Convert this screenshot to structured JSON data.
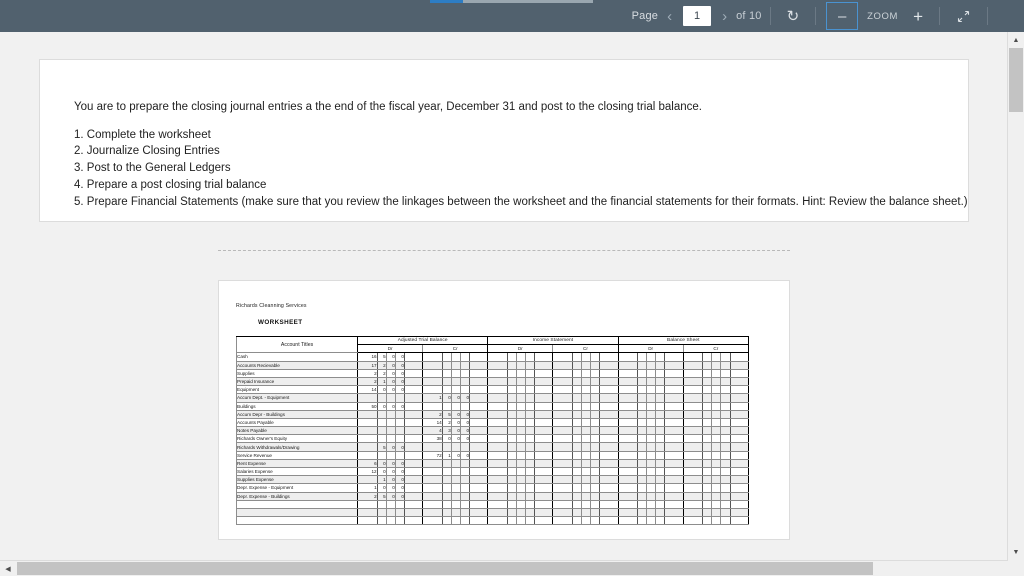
{
  "toolbar": {
    "page_label": "Page",
    "prev_icon": "chevron-left-icon",
    "page_value": "1",
    "next_icon": "chevron-right-icon",
    "of_label": "of 10",
    "rotate_icon": "rotate-icon",
    "zoom_out_label": "–",
    "zoom_label": "ZOOM",
    "zoom_in_label": "+",
    "fit_icon": "fit-to-width-icon",
    "accent_color": "#4a93d1",
    "bar_color": "#51616e"
  },
  "progress": {
    "percent": 20,
    "fill_color": "#2d7dc4",
    "track_color": "#9aa7b0"
  },
  "document": {
    "page1": {
      "lead": "You are to prepare the closing journal entries a the end of the fiscal year, December 31 and post to the closing trial balance.",
      "items": [
        "1. Complete the worksheet",
        "2. Journalize Closing Entries",
        "3. Post to the General Ledgers",
        "4. Prepare a post closing trial balance",
        "5. Prepare Financial Statements (make sure that you review the linkages between the worksheet and the financial statements for their formats.  Hint:  Review the balance sheet.)"
      ]
    },
    "page2": {
      "company": "Richards Cleanning Services",
      "title": "WORKSHEET",
      "account_header": "Account Titles",
      "groups": [
        "Adjusted Trial Balance",
        "Income Statement",
        "Balance Sheet"
      ],
      "dr_label": "Dr",
      "cr_label": "Cr",
      "rows": [
        {
          "account": "Cash",
          "atb_dr": [
            "16",
            "5",
            "0",
            "0"
          ],
          "atb_cr": [
            "",
            "",
            "",
            ""
          ]
        },
        {
          "account": "Accounts Recievable",
          "atb_dr": [
            "17",
            "2",
            "0",
            "0"
          ],
          "atb_cr": [
            "",
            "",
            "",
            ""
          ]
        },
        {
          "account": "Supplies",
          "atb_dr": [
            "2",
            "2",
            "0",
            "0"
          ],
          "atb_cr": [
            "",
            "",
            "",
            ""
          ]
        },
        {
          "account": "Prepaid Insurance",
          "atb_dr": [
            "2",
            "1",
            "0",
            "0"
          ],
          "atb_cr": [
            "",
            "",
            "",
            ""
          ]
        },
        {
          "account": "Equipment",
          "atb_dr": [
            "14",
            "0",
            "0",
            "0"
          ],
          "atb_cr": [
            "",
            "",
            "",
            ""
          ]
        },
        {
          "account": "Accum Dept. - Equipment",
          "atb_dr": [
            "",
            "",
            "",
            ""
          ],
          "atb_cr": [
            "1",
            "0",
            "0",
            "0"
          ]
        },
        {
          "account": "Buildings",
          "atb_dr": [
            "50",
            "0",
            "0",
            "0"
          ],
          "atb_cr": [
            "",
            "",
            "",
            ""
          ]
        },
        {
          "account": "Accum Depr - Buildings",
          "atb_dr": [
            "",
            "",
            "",
            ""
          ],
          "atb_cr": [
            "2",
            "5",
            "0",
            "0"
          ]
        },
        {
          "account": "Accounts Payable",
          "atb_dr": [
            "",
            "",
            "",
            ""
          ],
          "atb_cr": [
            "14",
            "2",
            "0",
            "0"
          ]
        },
        {
          "account": "Notes Payable",
          "atb_dr": [
            "",
            "",
            "",
            ""
          ],
          "atb_cr": [
            "4",
            "3",
            "0",
            "0"
          ]
        },
        {
          "account": "Richards Owner's Equity",
          "atb_dr": [
            "",
            "",
            "",
            ""
          ],
          "atb_cr": [
            "38",
            "0",
            "0",
            "0"
          ]
        },
        {
          "account": "Richards Withdrawals/Drawing",
          "atb_dr": [
            "",
            "5",
            "0",
            "0"
          ],
          "atb_cr": [
            "",
            "",
            "",
            ""
          ]
        },
        {
          "account": "Service Revenue",
          "atb_dr": [
            "",
            "",
            "",
            ""
          ],
          "atb_cr": [
            "72",
            "1",
            "0",
            "0"
          ]
        },
        {
          "account": "Rent Expense",
          "atb_dr": [
            "6",
            "0",
            "0",
            "0"
          ],
          "atb_cr": [
            "",
            "",
            "",
            ""
          ]
        },
        {
          "account": "Salaries Expense",
          "atb_dr": [
            "12",
            "0",
            "0",
            "0"
          ],
          "atb_cr": [
            "",
            "",
            "",
            ""
          ]
        },
        {
          "account": "Supplies Expense",
          "atb_dr": [
            "",
            "1",
            "0",
            "0"
          ],
          "atb_cr": [
            "",
            "",
            "",
            ""
          ]
        },
        {
          "account": "Depr. Expense - Equipment",
          "atb_dr": [
            "1",
            "0",
            "0",
            "0"
          ],
          "atb_cr": [
            "",
            "",
            "",
            ""
          ]
        },
        {
          "account": "Depr. Expense - Buildings",
          "atb_dr": [
            "2",
            "5",
            "0",
            "0"
          ],
          "atb_cr": [
            "",
            "",
            "",
            ""
          ]
        },
        {
          "account": "",
          "atb_dr": [
            "",
            "",
            "",
            ""
          ],
          "atb_cr": [
            "",
            "",
            "",
            ""
          ]
        },
        {
          "account": "",
          "atb_dr": [
            "",
            "",
            "",
            ""
          ],
          "atb_cr": [
            "",
            "",
            "",
            ""
          ]
        },
        {
          "account": "",
          "atb_dr": [
            "",
            "",
            "",
            ""
          ],
          "atb_cr": [
            "",
            "",
            "",
            ""
          ]
        }
      ]
    }
  },
  "scrollbars": {
    "v_up_icon": "caret-up-icon",
    "v_down_icon": "caret-down-icon",
    "h_left_icon": "caret-left-icon",
    "h_right_icon": "caret-right-icon"
  }
}
